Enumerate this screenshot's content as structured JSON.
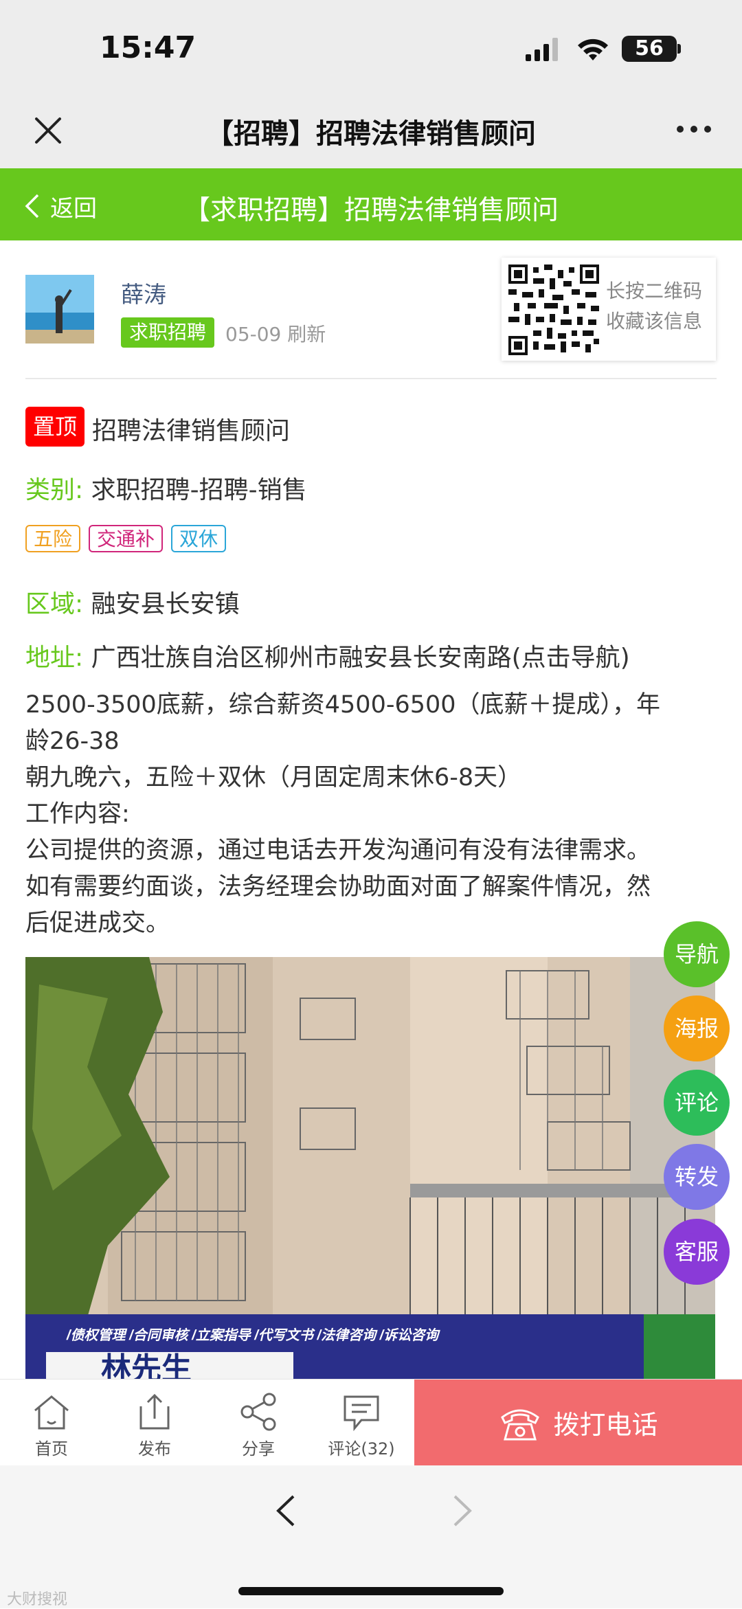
{
  "status": {
    "time": "15:47",
    "battery": "56"
  },
  "wechat": {
    "title": "【招聘】招聘法律销售顾问"
  },
  "nav": {
    "back_label": "返回",
    "title": "【求职招聘】招聘法律销售顾问"
  },
  "poster": {
    "author": "薛涛",
    "category_badge": "求职招聘",
    "refresh_text": "05-09 刷新",
    "qr_hint_line1": "长按二维码",
    "qr_hint_line2": "收藏该信息"
  },
  "post": {
    "top_badge": "置顶",
    "title": "招聘法律销售顾问",
    "category_label": "类别:",
    "category_value": "求职招聘-招聘-销售",
    "tags": [
      "五险",
      "交通补",
      "双休"
    ],
    "area_label": "区域:",
    "area_value": "融安县长安镇",
    "address_label": "地址:",
    "address_value": "广西壮族自治区柳州市融安县长安南路(点击导航)",
    "description": [
      "2500-3500底薪，综合薪资4500-6500（底薪＋提成），年",
      "龄26-38",
      "朝九晚六，五险＋双休（月固定周末休6-8天）",
      "工作内容:",
      "公司提供的资源，通过电话去开发沟通问有没有法律需求。",
      "如有需要约面谈，法务经理会协助面对面了解案件情况，然",
      "后促进成交。"
    ]
  },
  "photo": {
    "sign_text": "/债权管理 /合同审核 /立案指导 /代写文书 /法律咨询 /诉讼咨询",
    "sign_big": "林先生"
  },
  "float_buttons": {
    "nav": "导航",
    "poster": "海报",
    "comment": "评论",
    "share": "转发",
    "service": "客服"
  },
  "actions": {
    "home": "首页",
    "publish": "发布",
    "share": "分享",
    "comment": "评论(32)",
    "call": "拨打电话"
  },
  "watermark": "大财搜视",
  "colors": {
    "brand_green": "#67c81d",
    "call_red": "#f26b6e",
    "top_red": "#ff0000"
  }
}
